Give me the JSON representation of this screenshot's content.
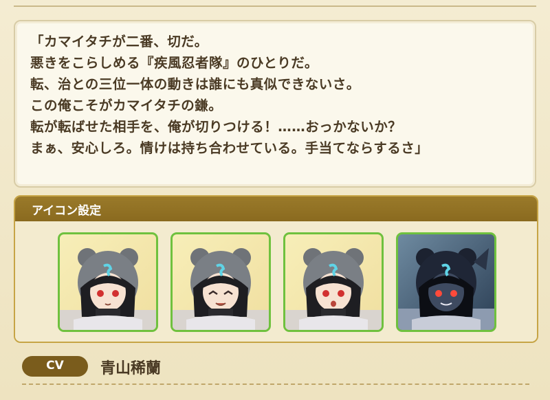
{
  "profile": {
    "quote_lines": [
      "「カマイタチが二番、切だ。",
      "悪きをこらしめる『疾風忍者隊』のひとりだ。",
      "転、治との三位一体の動きは誰にも真似できないさ。",
      "この俺こそがカマイタチの鎌。",
      "転が転ばせた相手を、俺が切りつける！……おっかないか？",
      "まぁ、安心しろ。情けは持ち合わせている。手当てならするさ」"
    ]
  },
  "icon_settings": {
    "title": "アイコン設定",
    "icons": [
      {
        "name": "normal-expression-icon",
        "variant": "normal"
      },
      {
        "name": "smiling-expression-icon",
        "variant": "smile"
      },
      {
        "name": "surprised-expression-icon",
        "variant": "surprised"
      },
      {
        "name": "dark-form-icon",
        "variant": "dark"
      }
    ],
    "frame_color": "#6fc13e"
  },
  "cv": {
    "label": "CV",
    "name": "青山稀蘭"
  },
  "colors": {
    "header_bg": "#8a6a1f",
    "text": "#4a3a24",
    "badge_bg": "#7a5c1c"
  }
}
